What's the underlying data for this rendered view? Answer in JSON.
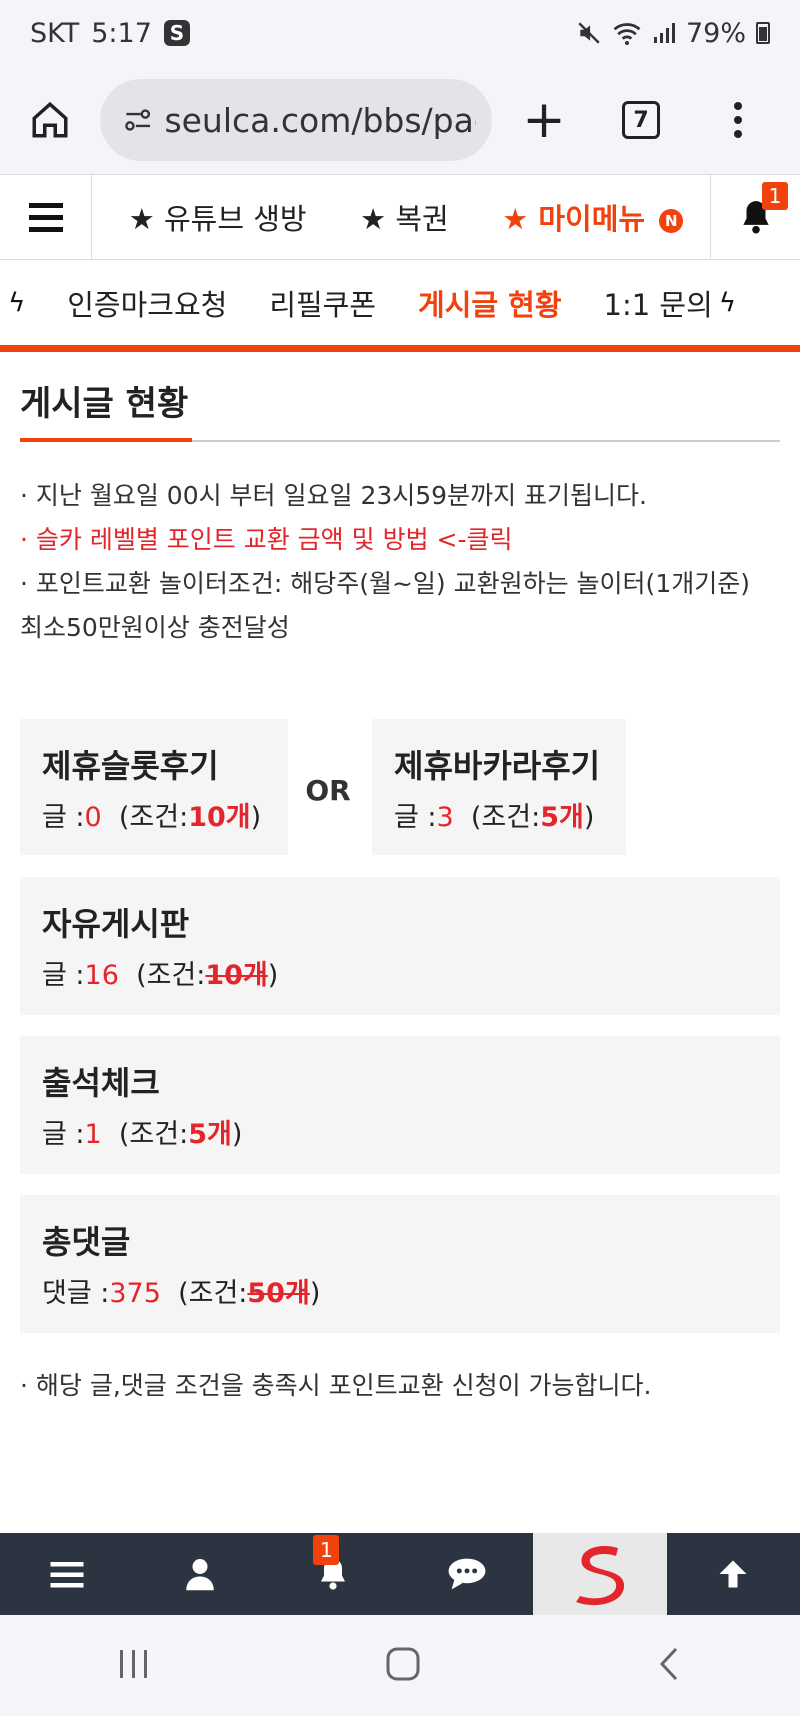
{
  "status_bar": {
    "carrier": "SKT",
    "time": "5:17",
    "s_badge": "S",
    "battery": "79%"
  },
  "browser": {
    "url": "seulca.com/bbs/page",
    "tabs_count": "7",
    "plus": "+"
  },
  "top_nav": {
    "items": [
      "★ 유튜브 생방",
      "★ 복권",
      "★ 마이메뉴"
    ],
    "new_badge": "N",
    "bell_count": "1"
  },
  "sub_nav": {
    "items": [
      "인증마크요청",
      "리필쿠폰",
      "게시글 현황",
      "1:1 문의"
    ],
    "partial_left": "l",
    "bolt": "ϟ"
  },
  "page": {
    "title": "게시글 현황",
    "notes": [
      "· 지난 월요일 00시 부터 일요일 23시59분까지 표기됩니다.",
      "· 슬카 레벨별 포인트 교환 금액 및 방법 <-클릭",
      "· 포인트교환 놀이터조건: 해당주(월~일) 교환원하는 놀이터(1개기준) 최소50만원이상 충전달성"
    ],
    "or_label": "OR",
    "cards": [
      {
        "title": "제휴슬롯후기",
        "label": "글 :",
        "count": "0",
        "cond_prefix": "(조건:",
        "req": "10개",
        "cond_suffix": ")"
      },
      {
        "title": "제휴바카라후기",
        "label": "글 :",
        "count": "3",
        "cond_prefix": "(조건:",
        "req": "5개",
        "cond_suffix": ")"
      },
      {
        "title": "자유게시판",
        "label": "글 :",
        "count": "16",
        "cond_prefix": "(조건:",
        "req": "10개",
        "cond_suffix": ")"
      },
      {
        "title": "출석체크",
        "label": "글 :",
        "count": "1",
        "cond_prefix": "(조건:",
        "req": "5개",
        "cond_suffix": ")"
      },
      {
        "title": "총댓글",
        "label": "댓글 :",
        "count": "375",
        "cond_prefix": "(조건:",
        "req": "50개",
        "cond_suffix": ")"
      }
    ],
    "footer_note": "· 해당 글,댓글 조건을 충족시 포인트교환 신청이 가능합니다."
  },
  "app_nav": {
    "bell_count": "1"
  },
  "colors": {
    "accent": "#f1420d",
    "red": "#e3262b",
    "nav_dark": "#2c3441"
  }
}
